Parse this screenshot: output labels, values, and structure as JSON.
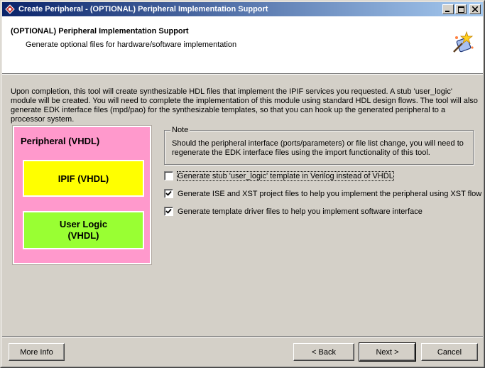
{
  "window": {
    "title": "Create Peripheral - (OPTIONAL) Peripheral Implementation Support",
    "controls": {
      "minimize": "_",
      "maximize": "□",
      "close": "✕"
    }
  },
  "header": {
    "title": "(OPTIONAL) Peripheral Implementation Support",
    "subtitle": "Generate optional files for hardware/software implementation",
    "icon": "wizard-wand-icon"
  },
  "intro_text": "Upon completion, this tool will create synthesizable HDL files that implement the IPIF services you requested. A stub 'user_logic' module will be created. You will need to complete the implementation of this module using standard HDL design flows. The tool will also generate EDK interface files (mpd/pao) for the synthesizable templates, so that you can hook up the generated peripheral to a processor system.",
  "diagram": {
    "outer_label": "Peripheral (VHDL)",
    "ipif_label": "IPIF (VHDL)",
    "user_logic_line1": "User Logic",
    "user_logic_line2": "(VHDL)",
    "colors": {
      "outer": "#ff99cc",
      "ipif": "#ffff00",
      "user_logic": "#99ff33"
    }
  },
  "note": {
    "legend": "Note",
    "text": "Should the peripheral interface (ports/parameters) or file list change, you will need to regenerate the EDK interface files using the import functionality of this tool."
  },
  "options": [
    {
      "label": "Generate stub 'user_logic' template in Verilog instead of VHDL",
      "checked": false
    },
    {
      "label": "Generate ISE and XST project files to help you implement the peripheral using XST flow",
      "checked": true
    },
    {
      "label": "Generate template driver files to help you implement software interface",
      "checked": true
    }
  ],
  "buttons": {
    "more_info": "More Info",
    "back": "< Back",
    "next": "Next >",
    "cancel": "Cancel"
  }
}
